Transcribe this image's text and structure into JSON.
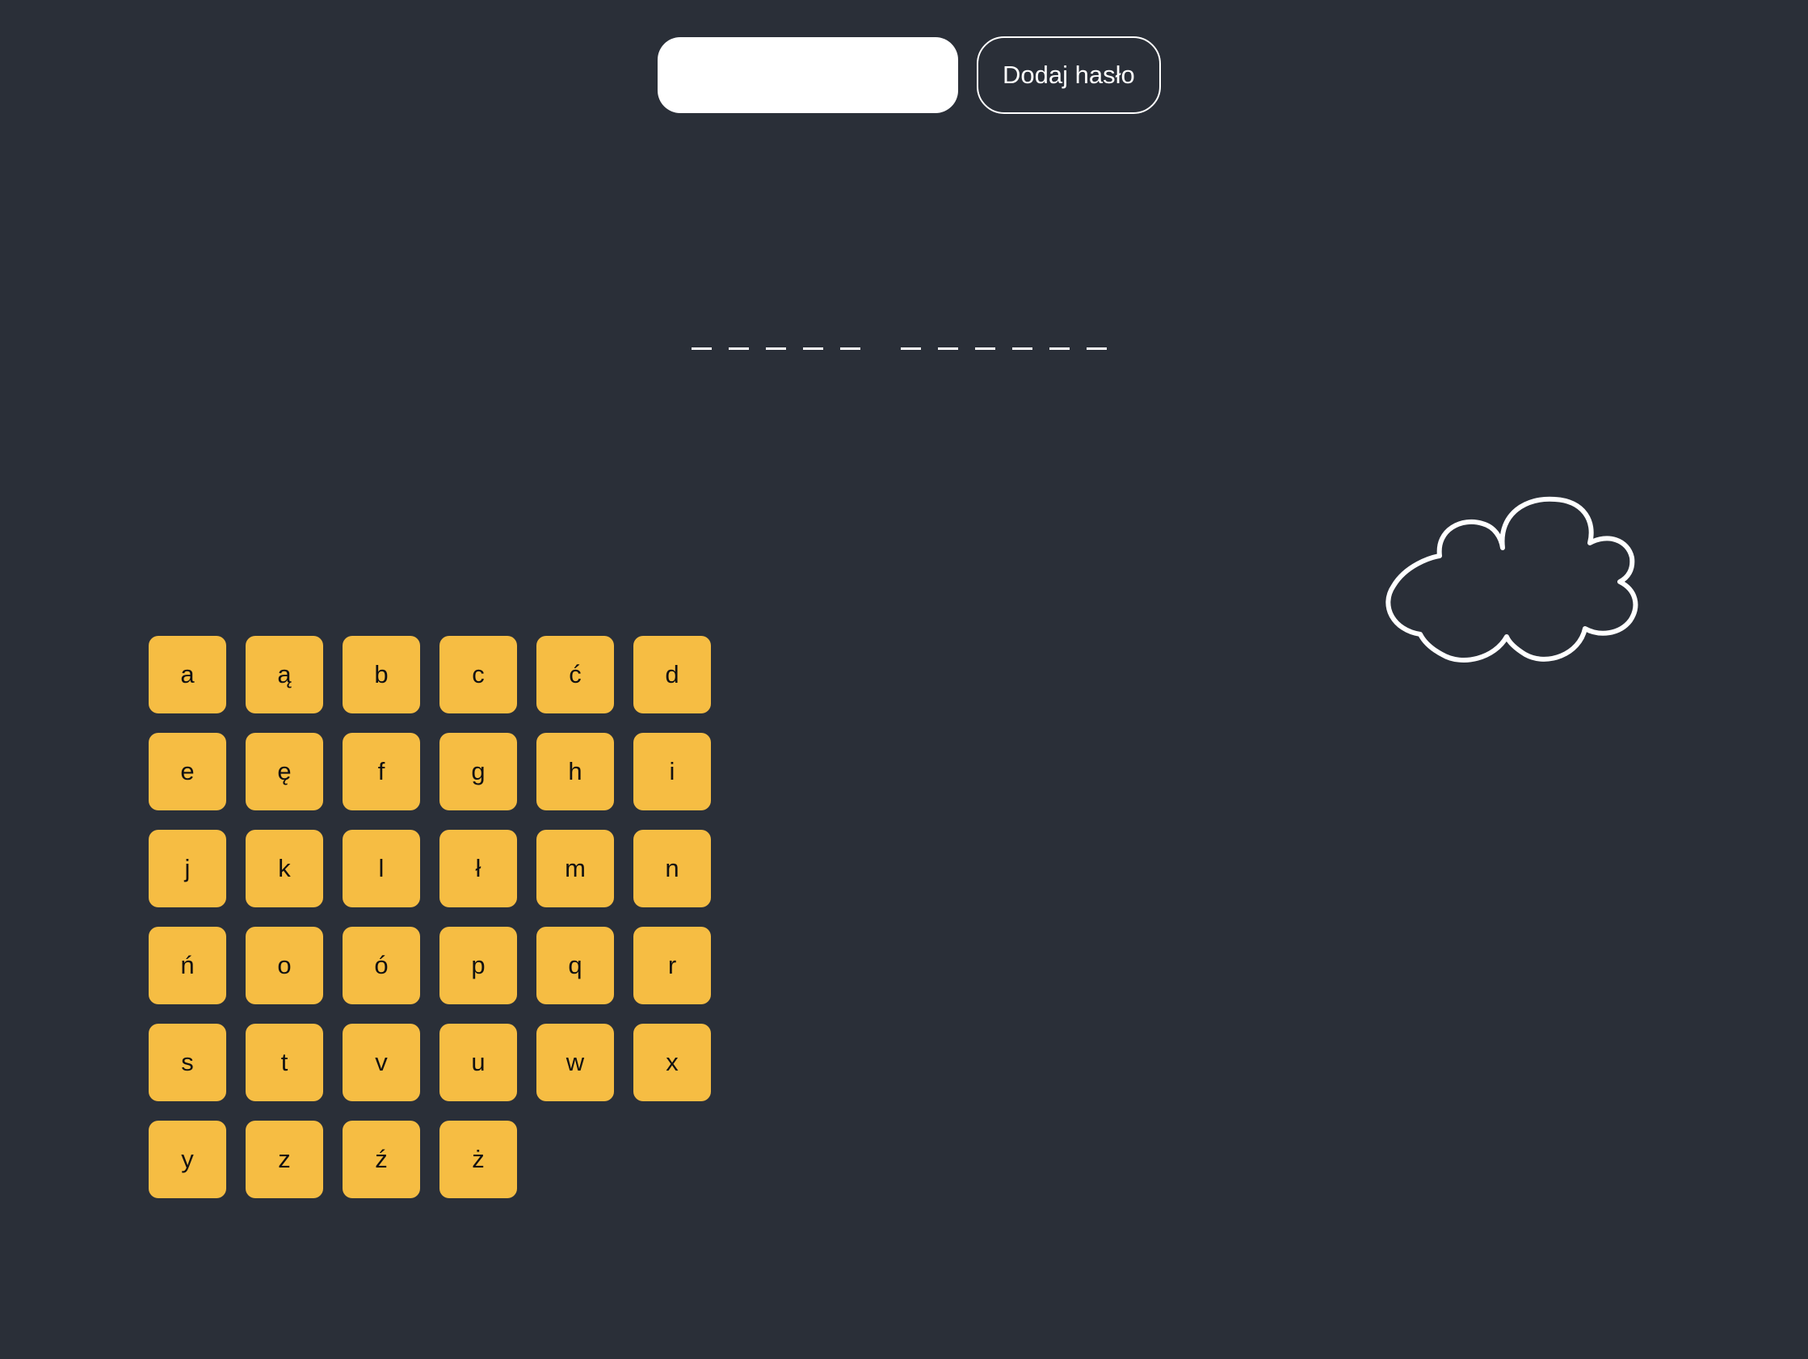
{
  "input": {
    "value": "",
    "placeholder": ""
  },
  "add_button_label": "Dodaj hasło",
  "words": [
    [
      "",
      "",
      "",
      "",
      ""
    ],
    [
      "",
      "",
      "",
      "",
      "",
      ""
    ]
  ],
  "letters": [
    "a",
    "ą",
    "b",
    "c",
    "ć",
    "d",
    "e",
    "ę",
    "f",
    "g",
    "h",
    "i",
    "j",
    "k",
    "l",
    "ł",
    "m",
    "n",
    "ń",
    "o",
    "ó",
    "p",
    "q",
    "r",
    "s",
    "t",
    "v",
    "u",
    "w",
    "x",
    "y",
    "z",
    "ź",
    "ż"
  ],
  "colors": {
    "background": "#2a2f38",
    "key": "#f6bd43",
    "accent": "#ffffff"
  },
  "icons": {
    "cloud": "cloud-icon"
  }
}
